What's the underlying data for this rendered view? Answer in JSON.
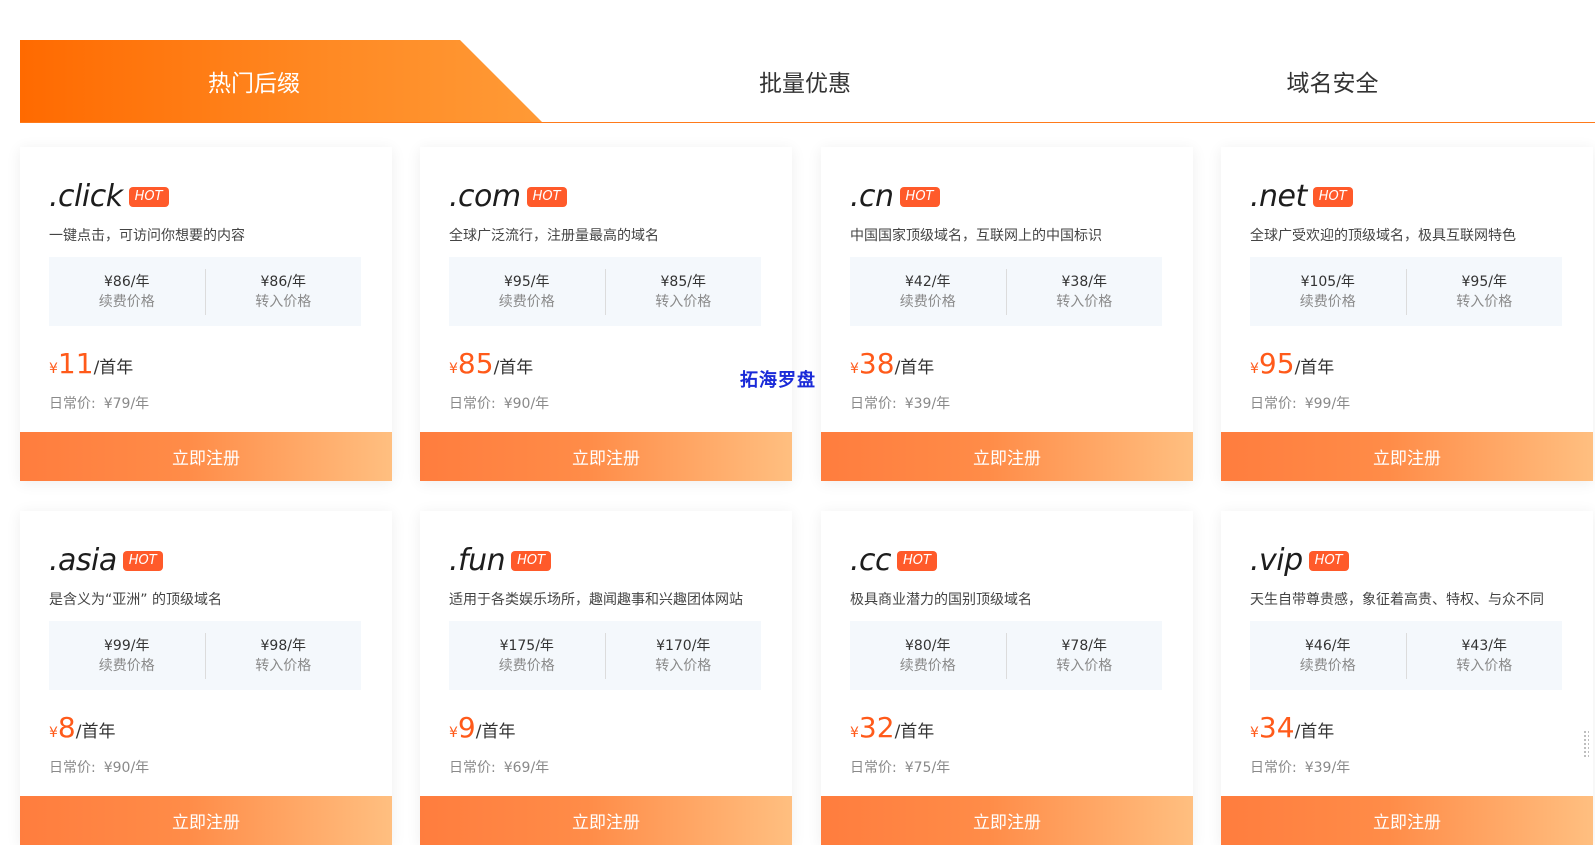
{
  "tabs": [
    {
      "label": "热门后缀",
      "active": true
    },
    {
      "label": "批量优惠",
      "active": false
    },
    {
      "label": "域名安全",
      "active": false
    }
  ],
  "colors": {
    "accent": "#ff6a00",
    "price": "#ff5a1a",
    "hot_badge": "#ff5a2a",
    "price_box_bg": "#f4f8fc"
  },
  "watermark": "拓海罗盘",
  "cards": [
    {
      "tld": ".click",
      "badge": "HOT",
      "desc": "一键点击，可访问你想要的内容",
      "renew_price": "¥86/年",
      "renew_label": "续费价格",
      "transfer_price": "¥86/年",
      "transfer_label": "转入价格",
      "currency": "¥",
      "first_year_price": "11",
      "first_year_unit": "/首年",
      "regular_label": "日常价:",
      "regular_price": "¥79/年",
      "register_label": "立即注册"
    },
    {
      "tld": ".com",
      "badge": "HOT",
      "desc": "全球广泛流行，注册量最高的域名",
      "renew_price": "¥95/年",
      "renew_label": "续费价格",
      "transfer_price": "¥85/年",
      "transfer_label": "转入价格",
      "currency": "¥",
      "first_year_price": "85",
      "first_year_unit": "/首年",
      "regular_label": "日常价:",
      "regular_price": "¥90/年",
      "register_label": "立即注册"
    },
    {
      "tld": ".cn",
      "badge": "HOT",
      "desc": "中国国家顶级域名，互联网上的中国标识",
      "renew_price": "¥42/年",
      "renew_label": "续费价格",
      "transfer_price": "¥38/年",
      "transfer_label": "转入价格",
      "currency": "¥",
      "first_year_price": "38",
      "first_year_unit": "/首年",
      "regular_label": "日常价:",
      "regular_price": "¥39/年",
      "register_label": "立即注册"
    },
    {
      "tld": ".net",
      "badge": "HOT",
      "desc": "全球广受欢迎的顶级域名，极具互联网特色",
      "renew_price": "¥105/年",
      "renew_label": "续费价格",
      "transfer_price": "¥95/年",
      "transfer_label": "转入价格",
      "currency": "¥",
      "first_year_price": "95",
      "first_year_unit": "/首年",
      "regular_label": "日常价:",
      "regular_price": "¥99/年",
      "register_label": "立即注册"
    },
    {
      "tld": ".asia",
      "badge": "HOT",
      "desc": "是含义为“亚洲” 的顶级域名",
      "renew_price": "¥99/年",
      "renew_label": "续费价格",
      "transfer_price": "¥98/年",
      "transfer_label": "转入价格",
      "currency": "¥",
      "first_year_price": "8",
      "first_year_unit": "/首年",
      "regular_label": "日常价:",
      "regular_price": "¥90/年",
      "register_label": "立即注册"
    },
    {
      "tld": ".fun",
      "badge": "HOT",
      "desc": "适用于各类娱乐场所，趣闻趣事和兴趣团体网站",
      "renew_price": "¥175/年",
      "renew_label": "续费价格",
      "transfer_price": "¥170/年",
      "transfer_label": "转入价格",
      "currency": "¥",
      "first_year_price": "9",
      "first_year_unit": "/首年",
      "regular_label": "日常价:",
      "regular_price": "¥69/年",
      "register_label": "立即注册"
    },
    {
      "tld": ".cc",
      "badge": "HOT",
      "desc": "极具商业潜力的国别顶级域名",
      "renew_price": "¥80/年",
      "renew_label": "续费价格",
      "transfer_price": "¥78/年",
      "transfer_label": "转入价格",
      "currency": "¥",
      "first_year_price": "32",
      "first_year_unit": "/首年",
      "regular_label": "日常价:",
      "regular_price": "¥75/年",
      "register_label": "立即注册"
    },
    {
      "tld": ".vip",
      "badge": "HOT",
      "desc": "天生自带尊贵感，象征着高贵、特权、与众不同",
      "renew_price": "¥46/年",
      "renew_label": "续费价格",
      "transfer_price": "¥43/年",
      "transfer_label": "转入价格",
      "currency": "¥",
      "first_year_price": "34",
      "first_year_unit": "/首年",
      "regular_label": "日常价:",
      "regular_price": "¥39/年",
      "register_label": "立即注册"
    }
  ]
}
